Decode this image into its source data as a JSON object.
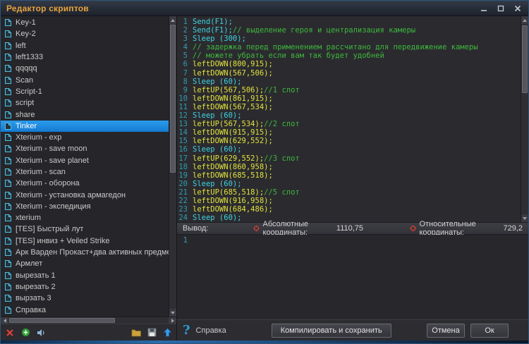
{
  "window": {
    "title": "Редактор скриптов"
  },
  "colors": {
    "title_text": "#e8a33d",
    "selection": "#1a80d8",
    "keyword": "#3fd2e0",
    "function": "#e2e23e",
    "comment": "#3db83d",
    "line_number": "#2e9db0",
    "crosshair": "#d04030"
  },
  "sidebar": {
    "selected_index": 9,
    "items": [
      "Key-1",
      "Key-2",
      "left",
      "left1333",
      "qqqqq",
      "Scan",
      "Script-1",
      "script",
      "share",
      "Tinker",
      "Xterium - exp",
      "Xterium - save moon",
      "Xterium - save planet",
      "Xterium - scan",
      "Xterium - оборона",
      "Xterium - установка армагедон",
      "Xterium - экспедиция",
      "xterium",
      "[TES] Быстрый лут",
      "[TES] инвиз + Veiled Strike",
      "Арк Варден Прокаст+два активных предмета",
      "Армлет",
      "вырезать 1",
      "вырезать 2",
      "вырзать 3",
      "Справка"
    ]
  },
  "editor": {
    "lines": [
      [
        {
          "text": "Send(F1);",
          "type": "keyword"
        }
      ],
      [
        {
          "text": "Send(F1);",
          "type": "keyword"
        },
        {
          "text": "// выделение героя и централизация камеры",
          "type": "comment"
        }
      ],
      [
        {
          "text": "Sleep (300);",
          "type": "keyword"
        }
      ],
      [
        {
          "text": "// задержка перед применением рассчитано для передвижение камеры",
          "type": "comment"
        }
      ],
      [
        {
          "text": "// можете убрать если вам так будет удобней",
          "type": "comment"
        }
      ],
      [
        {
          "text": "leftDOWN(800,915);",
          "type": "func"
        }
      ],
      [
        {
          "text": "leftDOWN(567,506);",
          "type": "func"
        }
      ],
      [
        {
          "text": "Sleep (60);",
          "type": "keyword"
        }
      ],
      [
        {
          "text": "leftUP(567,506);",
          "type": "func"
        },
        {
          "text": "//1 слот",
          "type": "comment"
        }
      ],
      [
        {
          "text": "leftDOWN(861,915);",
          "type": "func"
        }
      ],
      [
        {
          "text": "leftDOWN(567,534);",
          "type": "func"
        }
      ],
      [
        {
          "text": "Sleep (60);",
          "type": "keyword"
        }
      ],
      [
        {
          "text": "leftUP(567,534);",
          "type": "func"
        },
        {
          "text": "//2 слот",
          "type": "comment"
        }
      ],
      [
        {
          "text": "leftDOWN(915,915);",
          "type": "func"
        }
      ],
      [
        {
          "text": "leftDOWN(629,552);",
          "type": "func"
        }
      ],
      [
        {
          "text": "Sleep (60);",
          "type": "keyword"
        }
      ],
      [
        {
          "text": "leftUP(629,552);",
          "type": "func"
        },
        {
          "text": "//3 слот",
          "type": "comment"
        }
      ],
      [
        {
          "text": "leftDOWN(860,958);",
          "type": "func"
        }
      ],
      [
        {
          "text": "leftDOWN(685,518);",
          "type": "func"
        }
      ],
      [
        {
          "text": "Sleep (60);",
          "type": "keyword"
        }
      ],
      [
        {
          "text": "leftUP(685,518);",
          "type": "func"
        },
        {
          "text": "//5 слот",
          "type": "comment"
        }
      ],
      [
        {
          "text": "leftDOWN(916,958);",
          "type": "func"
        }
      ],
      [
        {
          "text": "leftDOWN(684,486);",
          "type": "func"
        }
      ],
      [
        {
          "text": "Sleep (60);",
          "type": "keyword"
        }
      ]
    ]
  },
  "output_panel": {
    "label": "Вывод:",
    "absolute": {
      "label": "Абсолютные координаты:",
      "value": "1110,75"
    },
    "relative": {
      "label": "Относительные координаты:",
      "value": "729,2"
    },
    "line_number": "1"
  },
  "footer": {
    "help_icon": "?",
    "help_label": "Справка",
    "compile_button": "Компилировать и сохранить",
    "cancel_button": "Отмена",
    "ok_button": "Ок"
  }
}
